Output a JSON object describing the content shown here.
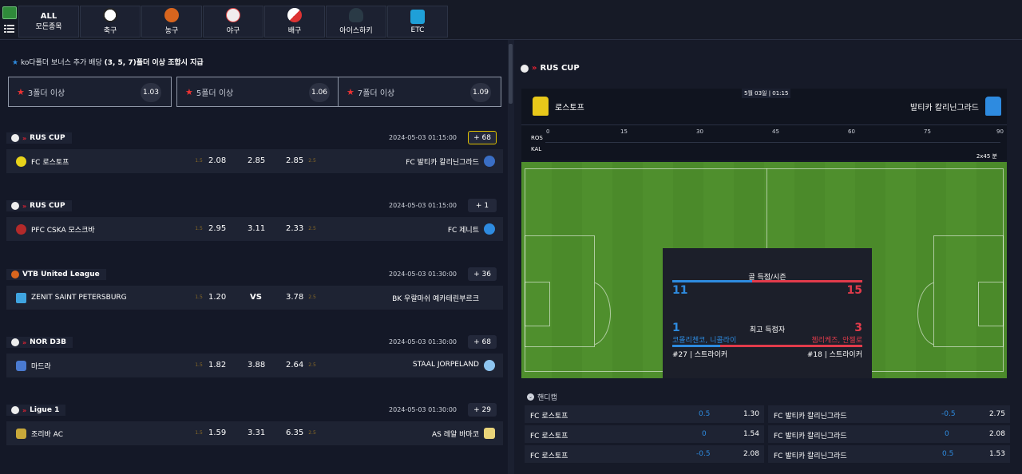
{
  "sports_nav": [
    {
      "label_top": "ALL",
      "label": "모든종목",
      "icon": "all-icon"
    },
    {
      "label": "축구",
      "icon": "soccer-ball-icon"
    },
    {
      "label": "농구",
      "icon": "basketball-icon"
    },
    {
      "label": "야구",
      "icon": "baseball-icon"
    },
    {
      "label": "배구",
      "icon": "volleyball-icon"
    },
    {
      "label": "아이스하키",
      "icon": "ice-hockey-icon"
    },
    {
      "label": "ETC",
      "icon": "etc-icon"
    }
  ],
  "bonus": {
    "title_prefix": "ko다폴더 보너스 추가 배당 ",
    "title_bold": "(3, 5, 7)폴더 이상 조합시 지급",
    "boxes": [
      {
        "label": "3폴더 이상",
        "odd": "1.03"
      },
      {
        "label": "5폴더 이상",
        "odd": "1.06"
      },
      {
        "label": "7폴더 이상",
        "odd": "1.09"
      }
    ]
  },
  "matches": [
    {
      "league": "RUS CUP",
      "time": "2024-05-03 01:15:00",
      "more": "+ 68",
      "home": "FC 로스토프",
      "h1": "1.5",
      "odd1": "2.08",
      "oddx": "2.85",
      "odd2": "2.85",
      "h2": "2.5",
      "away": "FC 발티카 칼리닌그라드"
    },
    {
      "league": "RUS CUP",
      "time": "2024-05-03 01:15:00",
      "more": "+ 1",
      "home": "PFC CSKA 모스크바",
      "h1": "1.5",
      "odd1": "2.95",
      "oddx": "3.11",
      "odd2": "2.33",
      "h2": "2.5",
      "away": "FC 제니트"
    },
    {
      "league": "VTB United League",
      "time": "2024-05-03 01:30:00",
      "more": "+ 36",
      "home": "ZENIT SAINT PETERSBURG",
      "h1": "1.5",
      "odd1": "1.20",
      "oddx": "VS",
      "odd2": "3.78",
      "h2": "2.5",
      "away": "BK 우랄마쉬 예카테린부르크"
    },
    {
      "league": "NOR D3B",
      "time": "2024-05-03 01:30:00",
      "more": "+ 68",
      "home": "마드라",
      "h1": "1.5",
      "odd1": "1.82",
      "oddx": "3.88",
      "odd2": "2.64",
      "h2": "2.5",
      "away": "STAAL JORPELAND"
    },
    {
      "league": "Ligue 1",
      "time": "2024-05-03 01:30:00",
      "more": "+ 29",
      "home": "조리바 AC",
      "h1": "1.5",
      "odd1": "1.59",
      "oddx": "3.31",
      "odd2": "6.35",
      "h2": "2.5",
      "away": "AS 레알 바마코"
    }
  ],
  "detail": {
    "league": "RUS CUP",
    "date": "5월 03일 | 01:15",
    "home": "로스토프",
    "away": "발티카 칼리닌그라드",
    "home_abbr": "ROS",
    "away_abbr": "KAL",
    "ticks": [
      "0",
      "15",
      "30",
      "45",
      "60",
      "75",
      "90"
    ],
    "duration": "2x45 분",
    "goals_title": "골 득점/시즌",
    "home_goals": "11",
    "away_goals": "15",
    "scorer_title": "최고 득점자",
    "home_scorer_goals": "1",
    "away_scorer_goals": "3",
    "home_scorer": "코몰리첸코, 니콜라이",
    "away_scorer": "쳄리케즈, 안젤로",
    "home_pos": "#27 | 스트라이커",
    "away_pos": "#18 | 스트라이커"
  },
  "handicap": {
    "title": "핸디캡",
    "rows": [
      {
        "home": "FC 로스토프",
        "hc_home": "0.5",
        "val_home": "1.30",
        "away": "FC 발티카 칼리닌그라드",
        "hc_away": "-0.5",
        "val_away": "2.75"
      },
      {
        "home": "FC 로스토프",
        "hc_home": "0",
        "val_home": "1.54",
        "away": "FC 발티카 칼리닌그라드",
        "hc_away": "0",
        "val_away": "2.08"
      },
      {
        "home": "FC 로스토프",
        "hc_home": "-0.5",
        "val_home": "2.08",
        "away": "FC 발티카 칼리닌그라드",
        "hc_away": "0.5",
        "val_away": "1.53"
      }
    ]
  },
  "colors": {
    "accent_red": "#e23b4b",
    "accent_blue": "#2e8be0",
    "field_green": "#4b8a2a",
    "highlight_yellow": "#e0c200"
  }
}
